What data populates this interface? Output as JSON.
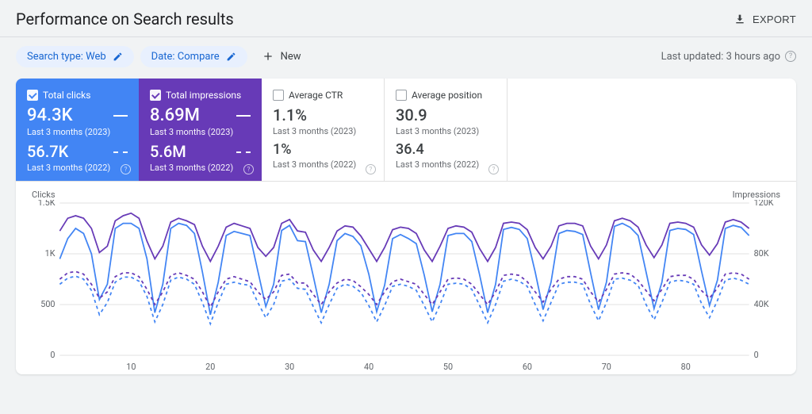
{
  "header": {
    "title": "Performance on Search results",
    "export_label": "EXPORT"
  },
  "filters": {
    "search_type": "Search type: Web",
    "date": "Date: Compare",
    "new_label": "New",
    "last_updated": "Last updated: 3 hours ago"
  },
  "metrics": [
    {
      "label": "Total clicks",
      "value_current": "94.3K",
      "period_current": "Last 3 months (2023)",
      "value_prev": "56.7K",
      "period_prev": "Last 3 months (2022)"
    },
    {
      "label": "Total impressions",
      "value_current": "8.69M",
      "period_current": "Last 3 months (2023)",
      "value_prev": "5.6M",
      "period_prev": "Last 3 months (2022)"
    },
    {
      "label": "Average CTR",
      "value_current": "1.1%",
      "period_current": "Last 3 months (2023)",
      "value_prev": "1%",
      "period_prev": "Last 3 months (2022)"
    },
    {
      "label": "Average position",
      "value_current": "30.9",
      "period_current": "Last 3 months (2023)",
      "value_prev": "36.4",
      "period_prev": "Last 3 months (2022)"
    }
  ],
  "chart_axis": {
    "left_label": "Clicks",
    "right_label": "Impressions"
  },
  "chart_data": {
    "type": "line",
    "title": "",
    "x": {
      "label": "",
      "ticks": [
        10,
        20,
        30,
        40,
        50,
        60,
        70,
        80
      ],
      "range": [
        1,
        88
      ]
    },
    "y_left": {
      "label": "Clicks",
      "ticks": [
        0,
        500,
        "1K",
        "1.5K"
      ],
      "range": [
        0,
        1500
      ]
    },
    "y_right": {
      "label": "Impressions",
      "ticks": [
        0,
        "40K",
        "80K",
        "120K"
      ],
      "range": [
        0,
        120000
      ]
    },
    "series": [
      {
        "name": "Clicks 2023",
        "axis": "left",
        "color": "#4285f4",
        "dash": "solid",
        "values": [
          950,
          1150,
          1250,
          1200,
          1000,
          550,
          700,
          1250,
          1300,
          1300,
          1250,
          950,
          420,
          700,
          1250,
          1300,
          1280,
          1200,
          820,
          400,
          720,
          1180,
          1220,
          1200,
          1180,
          830,
          480,
          700,
          1230,
          1280,
          1130,
          1120,
          780,
          420,
          700,
          1130,
          1200,
          1170,
          1080,
          800,
          430,
          690,
          1150,
          1190,
          1150,
          1100,
          790,
          430,
          700,
          1180,
          1200,
          1200,
          1120,
          790,
          420,
          700,
          1240,
          1260,
          1240,
          1150,
          820,
          450,
          720,
          1200,
          1230,
          1220,
          1190,
          810,
          450,
          720,
          1270,
          1300,
          1260,
          1180,
          820,
          460,
          720,
          1230,
          1250,
          1240,
          1190,
          830,
          490,
          740,
          1250,
          1280,
          1260,
          1180
        ]
      },
      {
        "name": "Clicks 2022",
        "axis": "left",
        "color": "#4285f4",
        "dash": "dashed",
        "values": [
          700,
          760,
          780,
          750,
          640,
          400,
          520,
          720,
          770,
          770,
          730,
          580,
          330,
          500,
          740,
          770,
          750,
          700,
          520,
          310,
          520,
          700,
          720,
          700,
          690,
          520,
          370,
          500,
          730,
          750,
          660,
          650,
          480,
          320,
          500,
          660,
          700,
          680,
          620,
          490,
          330,
          490,
          680,
          700,
          680,
          640,
          490,
          330,
          500,
          700,
          710,
          700,
          650,
          490,
          320,
          500,
          730,
          750,
          730,
          680,
          500,
          340,
          520,
          700,
          720,
          720,
          700,
          500,
          340,
          520,
          750,
          760,
          740,
          690,
          500,
          350,
          520,
          720,
          740,
          730,
          700,
          510,
          370,
          540,
          740,
          760,
          740,
          700
        ]
      },
      {
        "name": "Impressions 2023",
        "axis": "right",
        "color": "#673ab7",
        "dash": "solid",
        "values": [
          98000,
          108000,
          110000,
          108000,
          100000,
          81000,
          86000,
          106000,
          110000,
          112000,
          108000,
          90000,
          76000,
          86000,
          105000,
          108000,
          106000,
          103000,
          86000,
          74000,
          86000,
          101000,
          104000,
          102000,
          100000,
          85000,
          78000,
          85000,
          104000,
          107000,
          98000,
          97000,
          83000,
          74000,
          85000,
          98000,
          102000,
          101000,
          94000,
          84000,
          74000,
          85000,
          99000,
          101000,
          100000,
          96000,
          83000,
          74000,
          86000,
          100000,
          102000,
          101000,
          97000,
          84000,
          74000,
          85000,
          104000,
          105000,
          104000,
          99000,
          85000,
          76000,
          86000,
          102000,
          104000,
          104000,
          102000,
          86000,
          76000,
          87000,
          106000,
          108000,
          106000,
          101000,
          87000,
          77000,
          87000,
          104000,
          105000,
          104000,
          101000,
          87000,
          79000,
          88000,
          105000,
          107000,
          105000,
          100000
        ]
      },
      {
        "name": "Impressions 2022",
        "axis": "right",
        "color": "#673ab7",
        "dash": "dashed",
        "values": [
          60000,
          65000,
          66000,
          64000,
          56000,
          45000,
          50000,
          62000,
          65000,
          65000,
          62000,
          52000,
          40000,
          50000,
          63000,
          65000,
          63000,
          60000,
          50000,
          38000,
          50000,
          60000,
          62000,
          60000,
          58000,
          50000,
          44000,
          50000,
          63000,
          64000,
          57000,
          57000,
          48000,
          40000,
          50000,
          57000,
          60000,
          59000,
          54000,
          48000,
          40000,
          50000,
          58000,
          60000,
          58000,
          56000,
          48000,
          40000,
          50000,
          60000,
          61000,
          60000,
          56000,
          48000,
          40000,
          50000,
          63000,
          64000,
          63000,
          58000,
          50000,
          42000,
          52000,
          60000,
          62000,
          62000,
          60000,
          50000,
          42000,
          52000,
          64000,
          65000,
          64000,
          59000,
          51000,
          43000,
          52000,
          62000,
          63000,
          63000,
          60000,
          51000,
          45000,
          53000,
          64000,
          65000,
          64000,
          60000
        ]
      }
    ]
  }
}
